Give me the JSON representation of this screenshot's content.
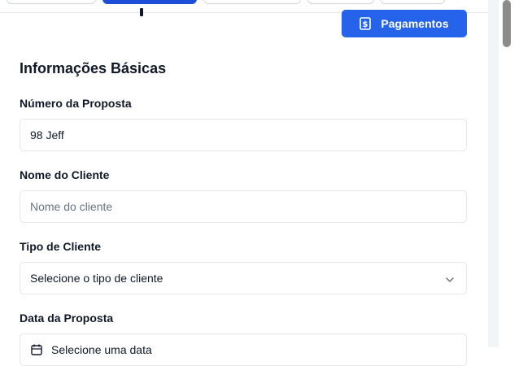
{
  "header": {
    "payments_button": "Pagamentos"
  },
  "section": {
    "title": "Informações Básicas"
  },
  "fields": {
    "proposal_number": {
      "label": "Número da Proposta",
      "value": "98 Jeff"
    },
    "client_name": {
      "label": "Nome do Cliente",
      "placeholder": "Nome do cliente"
    },
    "client_type": {
      "label": "Tipo de Cliente",
      "value": "Selecione o tipo de cliente"
    },
    "proposal_date": {
      "label": "Data da Proposta",
      "value": "Selecione uma data"
    }
  },
  "icons": {
    "payments": "dollar-document-icon",
    "select": "chevron-down-icon",
    "date": "calendar-icon"
  },
  "colors": {
    "accent": "#2563eb",
    "border": "#e5e7eb",
    "placeholder": "#6b7280"
  }
}
